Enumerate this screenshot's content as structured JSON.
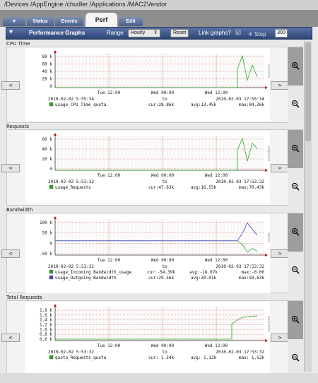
{
  "breadcrumb": "/Devices /AppEngine /chudler /Applications /MAC2Vendor",
  "tabs": {
    "arrow": "▼",
    "status": "Status",
    "events": "Events",
    "perf": "Perf",
    "edit": "Edit"
  },
  "toolbar": {
    "title": "Performance Graphs",
    "range_label": "Range",
    "range_value": "Hourly",
    "reset_label": "Reset",
    "link_label": "Link graphs?",
    "link_checked": true,
    "stop_label": "Stop",
    "interval_value": "300"
  },
  "nav": {
    "prev": "<",
    "next": ">"
  },
  "graphs": [
    {
      "title": "CPU Time",
      "ylabels": [
        "80 k",
        "60 k",
        "40 k",
        "20 k",
        "0"
      ],
      "xlabels": [
        "Tue 12:00",
        "Wed 00:00",
        "Wed 12:00"
      ],
      "range_start": "2010-02-02 5:55:34",
      "range_to": "to",
      "range_end": "2010-02-03 17:55:34",
      "vertical_label": "Seconds",
      "legend": [
        {
          "color": "#22aa22",
          "name": "usage_CPU Time_quota",
          "cur": "cur:28.86k",
          "avg": "avg:13.45k",
          "max": "max:84.26k"
        }
      ]
    },
    {
      "title": "Requests",
      "ylabels": [
        "60 k",
        "40 k",
        "20 k",
        "0"
      ],
      "xlabels": [
        "Tue 12:00",
        "Wed 00:00",
        "Wed 12:00"
      ],
      "range_start": "2010-02-02 5:53:32",
      "range_to": "to",
      "range_end": "2010-02-03 17:53:32",
      "vertical_label": "Requests",
      "legend": [
        {
          "color": "#22aa22",
          "name": "usage_Requests",
          "cur": "cur:47.63k",
          "avg": "avg:16.55k",
          "max": "max:70.43k"
        }
      ]
    },
    {
      "title": "Bandwidth",
      "ylabels": [
        "100 k",
        "50 k",
        "0",
        "-50 k"
      ],
      "xlabels": [
        "Tue 12:00",
        "Wed 00:00",
        "Wed 12:00"
      ],
      "range_start": "2010-02-02 5:53:32",
      "range_to": "to",
      "range_end": "2010-02-03 17:53:32",
      "vertical_label": "Bytes",
      "legend": [
        {
          "color": "#22aa22",
          "name": "usage_Incoming Bandwidth_usage",
          "cur": "cur:-54.39k",
          "avg": "avg:-18.07k",
          "max": "max:-0.00"
        },
        {
          "color": "#4444cc",
          "name": "usage_Outgoing Bandwidth",
          "cur": "cur:29.56k",
          "avg": "avg:20.01k",
          "max": "max:93.63k"
        }
      ]
    },
    {
      "title": "Total Requests",
      "ylabels": [
        "1.8 k",
        "1.6 k",
        "1.4 k",
        "1.2 k",
        "1.0 k",
        "0.8 k",
        "0.6 k"
      ],
      "xlabels": [
        "Tue 12:00",
        "Wed 00:00",
        "Wed 12:00"
      ],
      "range_start": "2010-02-02 5:53:32",
      "range_to": "to",
      "range_end": "2010-02-03 17:53:32",
      "vertical_label": "Requests",
      "legend": [
        {
          "color": "#22aa22",
          "name": "quota_Requests_quota",
          "cur": "cur: 1.54k",
          "avg": "avg: 1.12k",
          "max": "max: 1.52k"
        }
      ]
    }
  ],
  "chart_data": [
    {
      "type": "line",
      "title": "CPU Time",
      "ylim": [
        0,
        90000
      ],
      "x": [
        "Tue 12:00",
        "Wed 00:00",
        "Wed 12:00"
      ],
      "series": [
        {
          "name": "usage_CPU Time_quota",
          "values": [
            0,
            0,
            0,
            0,
            0,
            50000,
            84260,
            20000,
            60000,
            28860
          ]
        }
      ]
    },
    {
      "type": "line",
      "title": "Requests",
      "ylim": [
        0,
        75000
      ],
      "x": [
        "Tue 12:00",
        "Wed 00:00",
        "Wed 12:00"
      ],
      "series": [
        {
          "name": "usage_Requests",
          "values": [
            0,
            0,
            0,
            0,
            0,
            45000,
            70430,
            20000,
            60000,
            47630
          ]
        }
      ]
    },
    {
      "type": "line",
      "title": "Bandwidth",
      "ylim": [
        -75000,
        110000
      ],
      "x": [
        "Tue 12:00",
        "Wed 00:00",
        "Wed 12:00"
      ],
      "series": [
        {
          "name": "usage_Incoming Bandwidth_usage",
          "values": [
            0,
            0,
            0,
            0,
            -20000,
            -60000,
            -40000,
            -54390
          ]
        },
        {
          "name": "usage_Outgoing Bandwidth",
          "values": [
            0,
            0,
            0,
            0,
            40000,
            93630,
            60000,
            29560
          ]
        }
      ]
    },
    {
      "type": "line",
      "title": "Total Requests",
      "ylim": [
        500,
        1900
      ],
      "x": [
        "Tue 12:00",
        "Wed 00:00",
        "Wed 12:00"
      ],
      "series": [
        {
          "name": "quota_Requests_quota",
          "values": [
            560,
            560,
            560,
            560,
            1200,
            1450,
            1520,
            1540
          ]
        }
      ]
    }
  ]
}
